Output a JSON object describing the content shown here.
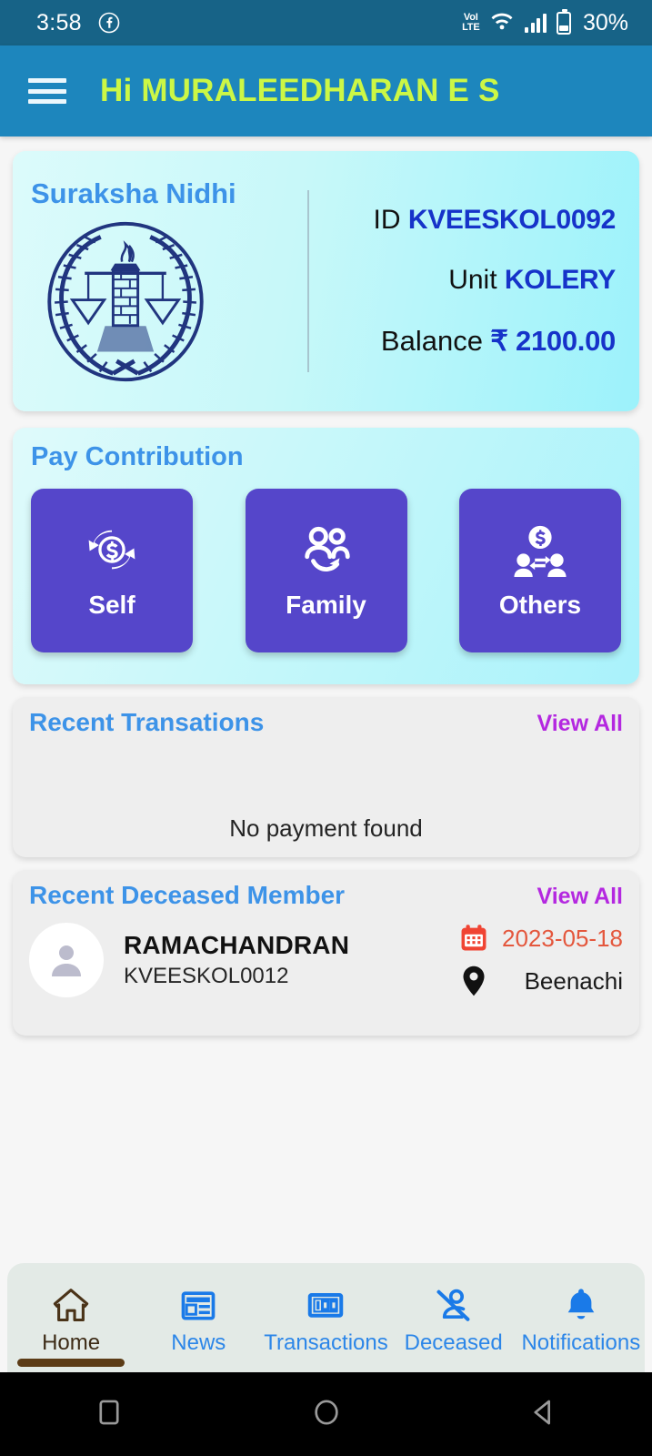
{
  "status_bar": {
    "time": "3:58",
    "app_icon": "facebook-icon",
    "network_type_top": "VoLTE",
    "network_type_line1": "VoI",
    "network_type_line2": "LTE",
    "wifi": "wifi-icon",
    "signal": "cellular-signal-icon",
    "battery_percent": "30%"
  },
  "app_bar": {
    "menu_icon": "hamburger-menu-icon",
    "title": "Hi MURALEEDHARAN E S",
    "title_color": "#ccf745",
    "bg_color": "#1d86bd"
  },
  "profile_card": {
    "title": "Suraksha Nidhi",
    "emblem": "justice-scales-emblem",
    "rows": [
      {
        "label": "ID",
        "value": "KVEESKOL0092"
      },
      {
        "label": "Unit",
        "value": "KOLERY"
      },
      {
        "label": "Balance",
        "value": "₹ 2100.00"
      }
    ],
    "id_label": "ID",
    "id_value": "KVEESKOL0092",
    "unit_label": "Unit",
    "unit_value": "KOLERY",
    "balance_label": "Balance",
    "balance_value": "₹ 2100.00",
    "value_color": "#1633c9"
  },
  "pay_contribution": {
    "title": "Pay Contribution",
    "title_color": "#3d93e8",
    "button_color": "#5546ca",
    "buttons": [
      {
        "label": "Self",
        "icon": "money-recycle-icon"
      },
      {
        "label": "Family",
        "icon": "family-group-icon"
      },
      {
        "label": "Others",
        "icon": "money-transfer-people-icon"
      }
    ]
  },
  "recent_transactions": {
    "title": "Recent Transations",
    "view_all": "View All",
    "empty_text": "No payment found"
  },
  "recent_deceased": {
    "title": "Recent Deceased Member",
    "view_all": "View All",
    "member": {
      "avatar": "person-avatar-icon",
      "name": "RAMACHANDRAN",
      "member_id": "KVEESKOL0012",
      "date_icon": "calendar-icon",
      "date": "2023-05-18",
      "place_icon": "location-pin-icon",
      "place": "Beenachi"
    }
  },
  "bottom_nav": {
    "active_index": 0,
    "active_color": "#3d2b16",
    "inactive_color": "#2c86e8",
    "items": [
      {
        "label": "Home",
        "icon": "home-icon"
      },
      {
        "label": "News",
        "icon": "newspaper-icon"
      },
      {
        "label": "Transactions",
        "icon": "banknote-100-icon"
      },
      {
        "label": "Deceased",
        "icon": "person-off-icon"
      },
      {
        "label": "Notifications",
        "icon": "bell-icon"
      }
    ]
  },
  "system_nav": {
    "items": [
      {
        "icon": "recents-square-icon"
      },
      {
        "icon": "home-circle-icon"
      },
      {
        "icon": "back-triangle-icon"
      }
    ]
  }
}
